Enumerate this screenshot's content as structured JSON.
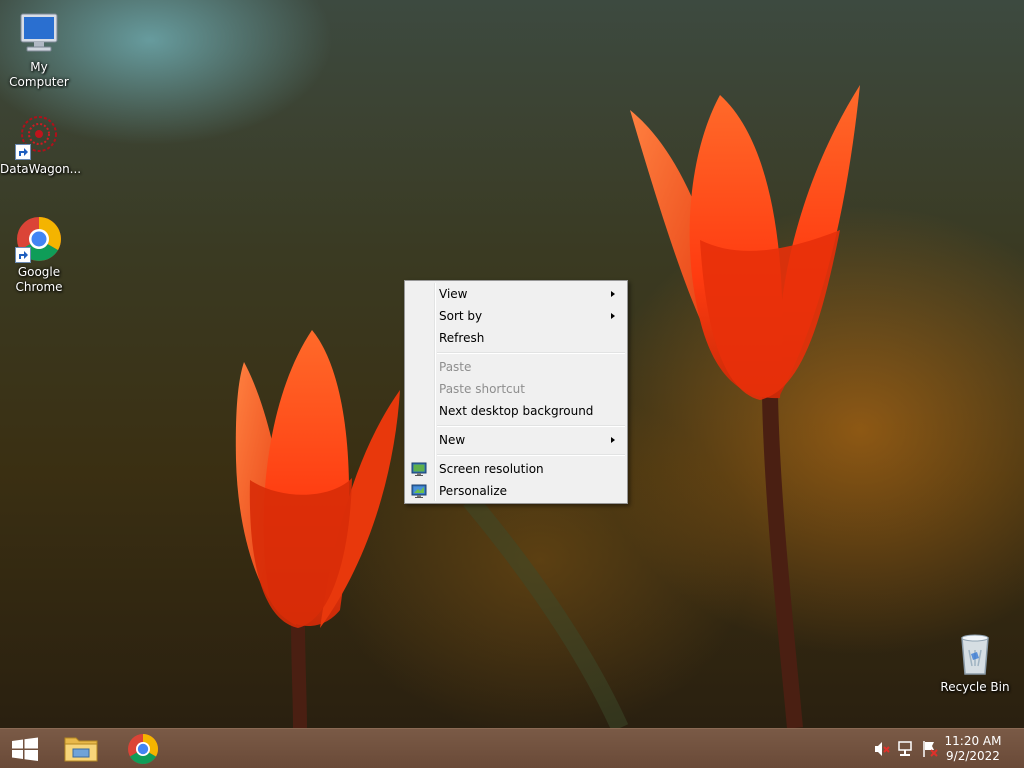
{
  "desktop": {
    "icons": [
      {
        "label": "My Computer"
      },
      {
        "label": "DataWagon..."
      },
      {
        "label_line1": "Google",
        "label_line2": "Chrome"
      },
      {
        "label": "Recycle Bin"
      }
    ]
  },
  "context_menu": {
    "view": "View",
    "sort_by": "Sort by",
    "refresh": "Refresh",
    "paste": "Paste",
    "paste_shortcut": "Paste shortcut",
    "next_background": "Next desktop background",
    "new": "New",
    "screen_resolution": "Screen resolution",
    "personalize": "Personalize"
  },
  "taskbar": {
    "time": "11:20 AM",
    "date": "9/2/2022",
    "pinned": [
      "file-explorer-icon",
      "chrome-icon"
    ],
    "tray_icons": [
      "volume-muted-icon",
      "network-icon",
      "action-center-flag-icon"
    ]
  },
  "colors": {
    "taskbar": "#6e4e3c",
    "menu_bg": "#f0f0f0",
    "tulip": "#ff4a12"
  }
}
